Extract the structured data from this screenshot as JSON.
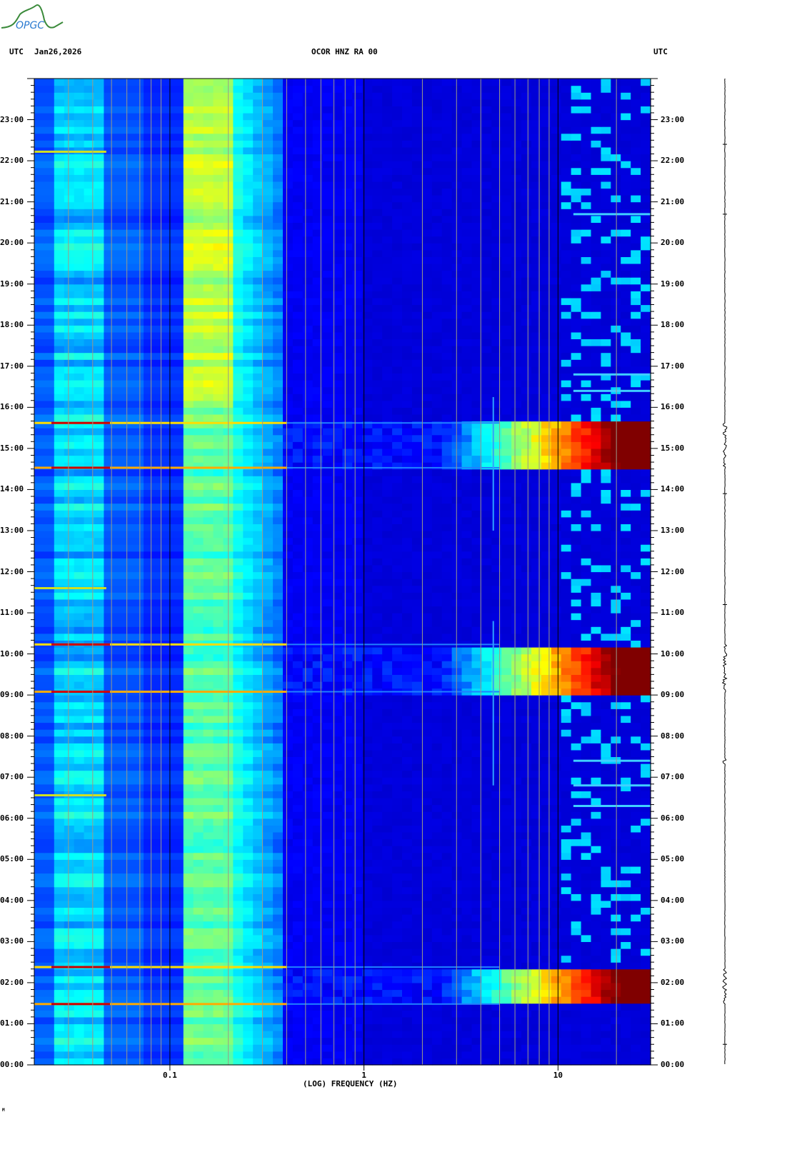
{
  "logo": {
    "text": "OPGC"
  },
  "header": {
    "left_tz": "UTC",
    "date": "Jan26,2026",
    "station": "OCOR HNZ RA 00",
    "right_tz": "UTC"
  },
  "footer": {
    "mark": "M"
  },
  "chart_data": {
    "type": "heatmap",
    "title": "OCOR HNZ RA 00",
    "xlabel": "(LOG) FREQUENCY (HZ)",
    "ylabel": "UTC",
    "xscale": "log",
    "xlim": [
      0.02,
      30
    ],
    "ylim_hours": [
      0,
      24
    ],
    "x_ticks": [
      {
        "value": 0.1,
        "label": "0.1"
      },
      {
        "value": 1,
        "label": "1"
      },
      {
        "value": 10,
        "label": "10"
      }
    ],
    "y_ticks": [
      "00:00",
      "01:00",
      "02:00",
      "03:00",
      "04:00",
      "05:00",
      "06:00",
      "07:00",
      "08:00",
      "09:00",
      "10:00",
      "11:00",
      "12:00",
      "13:00",
      "14:00",
      "15:00",
      "16:00",
      "17:00",
      "18:00",
      "19:00",
      "20:00",
      "21:00",
      "22:00",
      "23:00"
    ],
    "colormap": "jet",
    "colors": {
      "gridline_major": "#000000",
      "gridline_minor": "#9a9a8a",
      "logo_green": "#3a8a3a",
      "logo_blue": "#2a7ad0"
    },
    "microseism_peak_hz": [
      0.12,
      0.2
    ],
    "events": [
      {
        "start_h": 14.53,
        "end_h": 15.62,
        "type": "broadband",
        "peak_hz": 20
      },
      {
        "start_h": 9.08,
        "end_h": 10.23,
        "type": "broadband",
        "peak_hz": 20
      },
      {
        "start_h": 1.48,
        "end_h": 2.38,
        "type": "broadband",
        "peak_hz": 20
      }
    ],
    "low_freq_lines_h": [
      22.22,
      6.56,
      11.6
    ],
    "local_events_h": [
      7.4,
      6.8,
      6.3,
      16.4,
      16.8,
      20.7
    ]
  }
}
